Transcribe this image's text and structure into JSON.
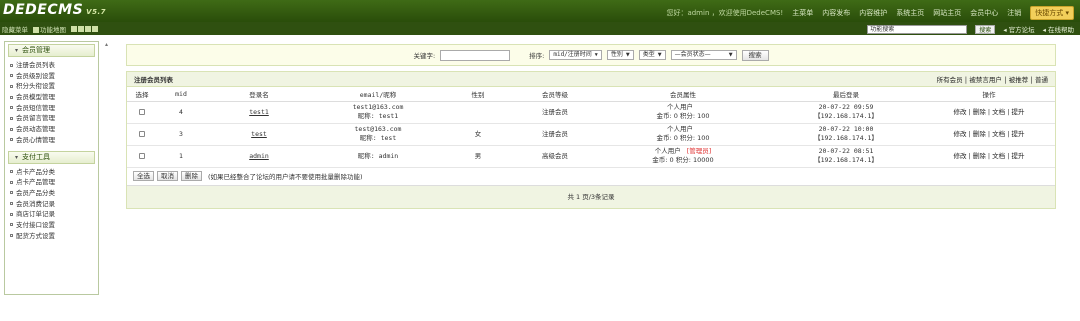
{
  "header": {
    "logo": "DEDECMS",
    "version": "V5.7",
    "welcome": "您好：admin ，欢迎使用DedeCMS!",
    "nav": [
      "主菜单",
      "内容发布",
      "内容维护",
      "系统主页",
      "网站主页",
      "会员中心",
      "注销"
    ],
    "quick": "快捷方式 ▾"
  },
  "subbar": {
    "hide_menu": "隐藏菜单",
    "sitemap": "功能地图",
    "search_placeholder": "功能搜索",
    "search_btn": "搜索",
    "forum": "官方论坛",
    "help": "在线帮助"
  },
  "sidebar": {
    "sections": [
      {
        "title": "会员管理",
        "items": [
          "注册会员列表",
          "会员级别设置",
          "积分头衔设置",
          "会员模型管理",
          "会员短信管理",
          "会员留言管理",
          "会员动态管理",
          "会员心情管理"
        ]
      },
      {
        "title": "支付工具",
        "items": [
          "点卡产品分类",
          "点卡产品管理",
          "会员产品分类",
          "会员消费记录",
          "商店订单记录",
          "支付接口设置",
          "配货方式设置"
        ]
      }
    ]
  },
  "filter": {
    "keyword_label": "关键字:",
    "sort_label": "排序:",
    "sort_value": "mid/注册时间",
    "gender_value": "性别",
    "type_value": "类型",
    "status_value": "—会员状态—",
    "search_btn": "搜索"
  },
  "panel": {
    "title": "注册会员列表",
    "links": [
      "所有会员",
      "被禁言用户",
      "被推荐",
      "普通"
    ],
    "columns": [
      "选择",
      "mid",
      "登录名",
      "email/昵称",
      "性别",
      "会员等级",
      "会员属性",
      "最后登录",
      "操作"
    ],
    "rows": [
      {
        "mid": "4",
        "login": "test1",
        "email": "test1@163.com",
        "nick": "昵称: test1",
        "gender": "",
        "level": "注册会员",
        "type": "个人用户",
        "admin_tag": "",
        "money": "金币: 0 积分: 100",
        "last_time": "20-07-22 09:59",
        "last_ip": "【192.168.174.1】"
      },
      {
        "mid": "3",
        "login": "test",
        "email": "test@163.com",
        "nick": "昵称: test",
        "gender": "女",
        "level": "注册会员",
        "type": "个人用户",
        "admin_tag": "",
        "money": "金币: 0 积分: 100",
        "last_time": "20-07-22 10:00",
        "last_ip": "【192.168.174.1】"
      },
      {
        "mid": "1",
        "login": "admin",
        "email": "",
        "nick": "昵称: admin",
        "gender": "男",
        "level": "高级会员",
        "type": "个人用户",
        "admin_tag": "[管理员]",
        "money": "金币: 0 积分: 10000",
        "last_time": "20-07-22 08:51",
        "last_ip": "【192.168.174.1】"
      }
    ],
    "ops": [
      "修改",
      "删除",
      "文档",
      "提升"
    ],
    "select_all": "全选",
    "cancel": "取消",
    "delete": "删除",
    "note": "(如果已经整合了论坛的用户请不要使用批量删除功能)",
    "pager": "共 1 页/3条记录"
  },
  "colors": {
    "header_green": "#2a4d0a",
    "panel_bg": "#f0f4e2",
    "admin_red": "#e03030"
  }
}
